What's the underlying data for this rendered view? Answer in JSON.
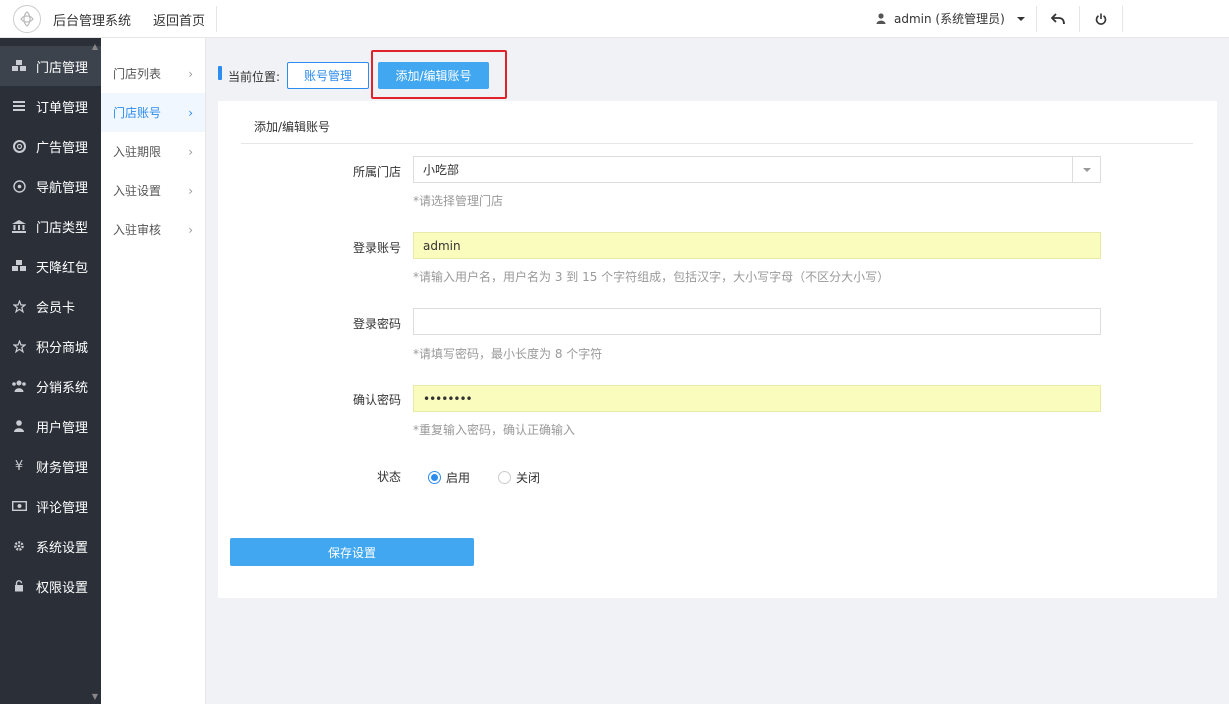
{
  "header": {
    "app_title": "后台管理系统",
    "home_link": "返回首页",
    "user_label": "admin (系统管理员)"
  },
  "sidebar": {
    "items": [
      {
        "label": "门店管理",
        "icon": "cubes-icon"
      },
      {
        "label": "订单管理",
        "icon": "list-icon"
      },
      {
        "label": "广告管理",
        "icon": "lifebuoy-icon"
      },
      {
        "label": "导航管理",
        "icon": "compass-icon"
      },
      {
        "label": "门店类型",
        "icon": "bank-icon"
      },
      {
        "label": "天降红包",
        "icon": "cubes-icon"
      },
      {
        "label": "会员卡",
        "icon": "star-icon"
      },
      {
        "label": "积分商城",
        "icon": "star-icon"
      },
      {
        "label": "分销系统",
        "icon": "users-icon"
      },
      {
        "label": "用户管理",
        "icon": "user-icon"
      },
      {
        "label": "财务管理",
        "icon": "yen-icon"
      },
      {
        "label": "评论管理",
        "icon": "money-icon"
      },
      {
        "label": "系统设置",
        "icon": "gear-icon"
      },
      {
        "label": "权限设置",
        "icon": "lock-icon"
      }
    ]
  },
  "submenu": {
    "items": [
      {
        "label": "门店列表"
      },
      {
        "label": "门店账号"
      },
      {
        "label": "入驻期限"
      },
      {
        "label": "入驻设置"
      },
      {
        "label": "入驻审核"
      }
    ]
  },
  "breadcrumb": {
    "label": "当前位置:",
    "btn_accounts": "账号管理",
    "btn_add_edit": "添加/编辑账号"
  },
  "form": {
    "title": "添加/编辑账号",
    "store": {
      "label": "所属门店",
      "value": "小吃部",
      "hint": "*请选择管理门店"
    },
    "username": {
      "label": "登录账号",
      "value": "admin",
      "hint": "*请输入用户名，用户名为 3 到 15 个字符组成，包括汉字，大小写字母（不区分大小写）"
    },
    "password": {
      "label": "登录密码",
      "value": "",
      "hint": "*请填写密码，最小长度为 8 个字符"
    },
    "confirm": {
      "label": "确认密码",
      "value": "••••••••",
      "hint": "*重复输入密码，确认正确输入"
    },
    "status": {
      "label": "状态",
      "on": "启用",
      "off": "关闭",
      "selected": "启用"
    },
    "save_label": "保存设置"
  },
  "colors": {
    "accent": "#2d8cf0",
    "button": "#41a7f1",
    "sidebar_bg": "#2b3038",
    "highlight": "#e0232a",
    "autofill": "#fafcbd"
  }
}
